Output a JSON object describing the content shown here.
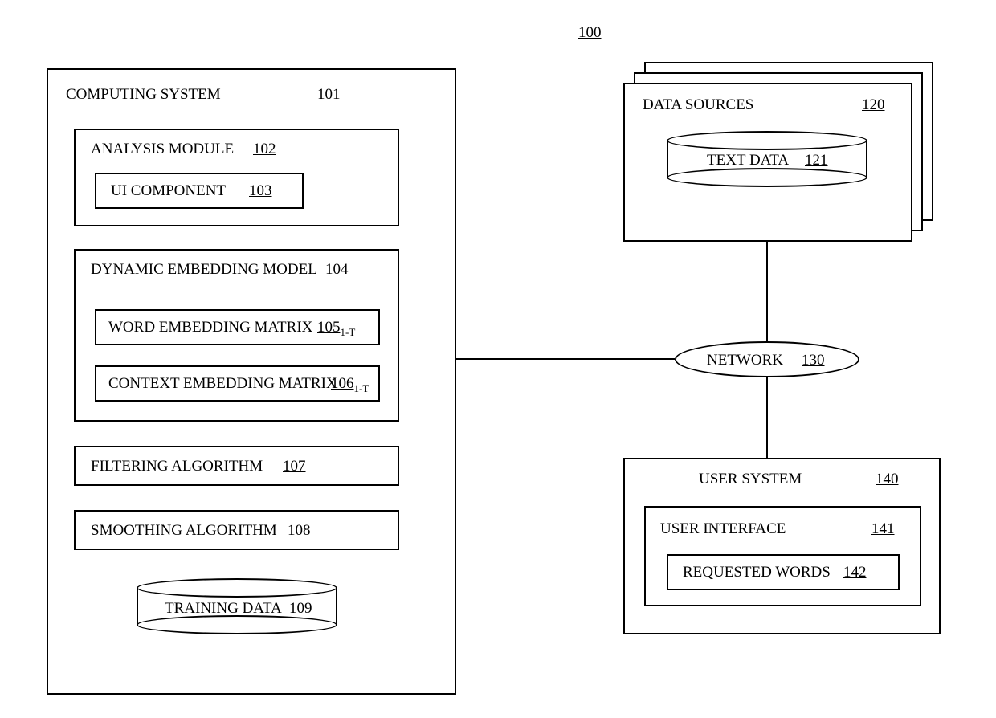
{
  "figure_ref": "100",
  "computing_system": {
    "title": "COMPUTING SYSTEM",
    "ref": "101",
    "analysis_module": {
      "title": "ANALYSIS MODULE",
      "ref": "102"
    },
    "ui_component": {
      "title": "UI COMPONENT",
      "ref": "103"
    },
    "dynamic_embedding_model": {
      "title": "DYNAMIC EMBEDDING MODEL",
      "ref": "104"
    },
    "word_embedding_matrix": {
      "title": "WORD EMBEDDING MATRIX",
      "ref": "105",
      "sub": "1-T"
    },
    "context_embedding_matrix": {
      "title": "CONTEXT EMBEDDING MATRIX",
      "ref": "106",
      "sub": "1-T"
    },
    "filtering_algorithm": {
      "title": "FILTERING ALGORITHM",
      "ref": "107"
    },
    "smoothing_algorithm": {
      "title": "SMOOTHING ALGORITHM",
      "ref": "108"
    },
    "training_data": {
      "title": "TRAINING DATA",
      "ref": "109"
    }
  },
  "data_sources": {
    "title": "DATA SOURCES",
    "ref": "120",
    "text_data": {
      "title": "TEXT DATA",
      "ref": "121"
    }
  },
  "network": {
    "title": "NETWORK",
    "ref": "130"
  },
  "user_system": {
    "title": "USER SYSTEM",
    "ref": "140",
    "user_interface": {
      "title": "USER INTERFACE",
      "ref": "141"
    },
    "requested_words": {
      "title": "REQUESTED WORDS",
      "ref": "142"
    }
  }
}
